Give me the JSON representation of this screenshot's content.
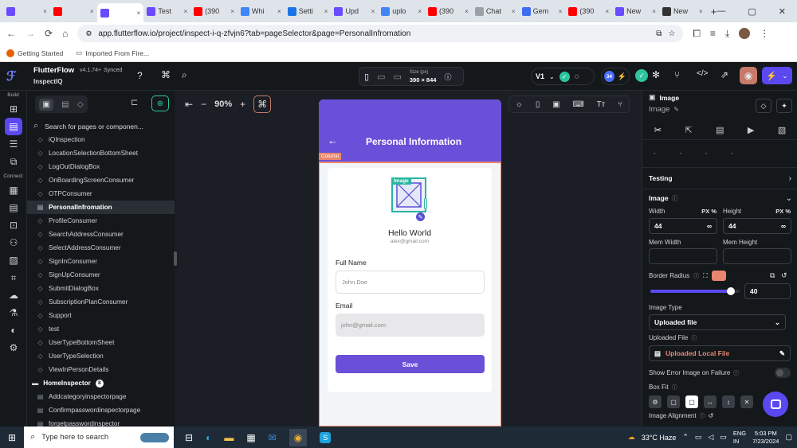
{
  "browser": {
    "tabs": [
      {
        "label": "",
        "icon": "flutterflow-favicon",
        "color": "#6a4bff"
      },
      {
        "label": "",
        "icon": "youtube-favicon",
        "color": "#ff0000"
      },
      {
        "label": "",
        "icon": "flutterflow-favicon",
        "color": "#6a4bff",
        "active": true
      },
      {
        "label": "Test",
        "icon": "flutterflow-favicon",
        "color": "#6a4bff"
      },
      {
        "label": "(390",
        "icon": "youtube-favicon",
        "color": "#ff0000"
      },
      {
        "label": "Whi",
        "icon": "google-favicon",
        "color": "#4285f4"
      },
      {
        "label": "Setti",
        "icon": "gear-favicon",
        "color": "#1a73e8"
      },
      {
        "label": "Upd",
        "icon": "flutterflow-favicon",
        "color": "#6a4bff"
      },
      {
        "label": "uplo",
        "icon": "google-favicon",
        "color": "#4285f4"
      },
      {
        "label": "(390",
        "icon": "youtube-favicon",
        "color": "#ff0000"
      },
      {
        "label": "Chat",
        "icon": "chatgpt-favicon",
        "color": "#9aa0a6"
      },
      {
        "label": "Gem",
        "icon": "gemini-favicon",
        "color": "#3c6df0"
      },
      {
        "label": "(390",
        "icon": "youtube-favicon",
        "color": "#ff0000"
      },
      {
        "label": "New",
        "icon": "flutterflow-favicon",
        "color": "#6a4bff"
      },
      {
        "label": "New",
        "icon": "github-favicon",
        "color": "#333333"
      }
    ],
    "new_tab": "+",
    "url": "app.flutterflow.io/project/inspect-i-q-zfvjn6?tab=pageSelector&page=PersonalInfromation",
    "bookmarks": [
      {
        "label": "Getting Started",
        "icon": "firefox-icon"
      },
      {
        "label": "Imported From Fire...",
        "icon": "folder-icon"
      }
    ]
  },
  "app": {
    "name": "FlutterFlow",
    "version": "v4.1.74+",
    "sync": "Synced",
    "project": "InspectIQ",
    "zoom": "90%",
    "size_label": "Size (px)",
    "size_value": "390 × 844",
    "version_select": "V1",
    "badge_count": "34"
  },
  "rail": {
    "build_label": "Build",
    "connect_label": "Connect"
  },
  "nav": {
    "search_placeholder": "Search for pages or componen...",
    "items": [
      "iQInspection",
      "LocationSelectionBottomSheet",
      "LogOutDialogBox",
      "OnBoardingScreenConsumer",
      "OTPConsumer",
      "PersonalInfromation",
      "ProfileConsumer",
      "SearchAddressConsumer",
      "SelectAddressConsumer",
      "SignInConsumer",
      "SignUpConsumer",
      "SubmitDialogBox",
      "SubscriptionPlanConsumer",
      "Support",
      "test",
      "UserTypeBottomSheet",
      "UserTypeSelection",
      "ViewInPersonDetails"
    ],
    "selected_index": 5,
    "folder": {
      "label": "HomeInspector",
      "count": "8"
    },
    "folder_items": [
      "Addcategoryinspectorpage",
      "Confirmpasswordinspectorpage",
      "forgetpasswordinspector"
    ]
  },
  "phone": {
    "header_title": "Personal Information",
    "column_tag": "Column",
    "image_tag": "Image",
    "name": "Hello World",
    "email_display": "alex@gmail.com",
    "full_name_label": "Full Name",
    "full_name_placeholder": "John Doe",
    "email_label": "Email",
    "email_value": "john@gmail.com",
    "save_label": "Save",
    "header_color": "#6a4fd8",
    "button_color": "#6a4fd8"
  },
  "props": {
    "widget": "Image",
    "widget_name": "Image",
    "testing": "Testing",
    "image_section": "Image",
    "width_label": "Width",
    "height_label": "Height",
    "width_value": "44",
    "height_value": "44",
    "unit": "PX %",
    "inf": "∞",
    "min_width": "Mem Width",
    "min_height": "Mem Height",
    "border_radius": "Border Radius",
    "border_radius_value": "40",
    "slider_value": 0.9,
    "image_type_label": "Image Type",
    "image_type_value": "Uploaded file",
    "uploaded_file_label": "Uploaded File",
    "uploaded_file_value": "Uploaded Local File",
    "show_error": "Show Error Image on Failure",
    "box_fit": "Box Fit",
    "image_alignment": "Image Alignment"
  },
  "taskbar": {
    "search_placeholder": "Type here to search",
    "weather": "33°C  Haze",
    "lang": "ENG",
    "region": "IN",
    "time": "5:03 PM",
    "date": "7/23/2024"
  }
}
